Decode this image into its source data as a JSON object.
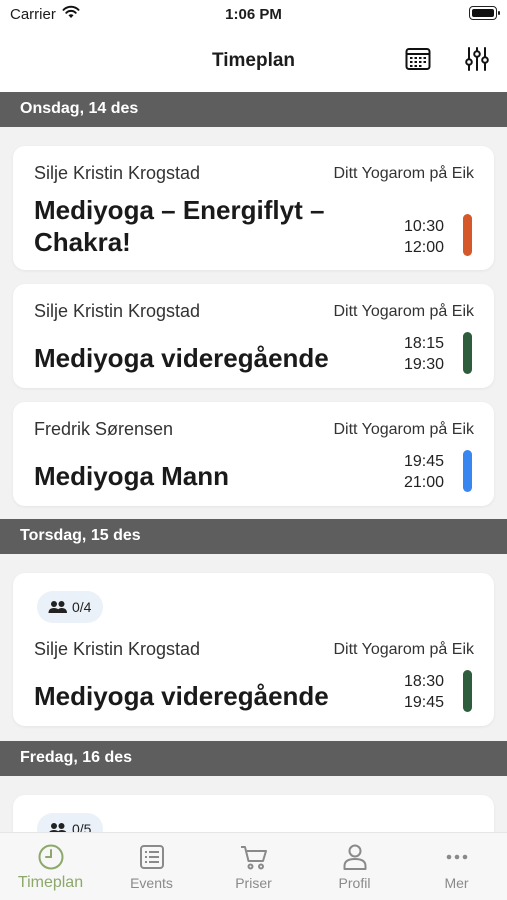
{
  "status_bar": {
    "carrier": "Carrier",
    "time": "1:06 PM"
  },
  "header": {
    "title": "Timeplan"
  },
  "sections": [
    {
      "date": "Onsdag, 14 des",
      "classes": [
        {
          "instructor": "Silje Kristin Krogstad",
          "location": "Ditt Yogarom på Eik",
          "title": "Mediyoga – Energiflyt – Chakra!",
          "start": "10:30",
          "end": "12:00",
          "color": "#d4582a"
        },
        {
          "instructor": "Silje Kristin Krogstad",
          "location": "Ditt Yogarom på Eik",
          "title": "Mediyoga videregående",
          "start": "18:15",
          "end": "19:30",
          "color": "#2d5d3c"
        },
        {
          "instructor": "Fredrik Sørensen",
          "location": "Ditt Yogarom på Eik",
          "title": "Mediyoga Mann",
          "start": "19:45",
          "end": "21:00",
          "color": "#3a86f0"
        }
      ]
    },
    {
      "date": "Torsdag, 15 des",
      "classes": [
        {
          "capacity": "0/4",
          "instructor": "Silje Kristin Krogstad",
          "location": "Ditt Yogarom på Eik",
          "title": "Mediyoga videregående",
          "start": "18:30",
          "end": "19:45",
          "color": "#2d5d3c"
        }
      ]
    },
    {
      "date": "Fredag, 16 des",
      "classes": [
        {
          "capacity": "0/5"
        }
      ]
    }
  ],
  "tabs": [
    {
      "label": "Timeplan",
      "icon": "clock-icon"
    },
    {
      "label": "Events",
      "icon": "list-icon"
    },
    {
      "label": "Priser",
      "icon": "cart-icon"
    },
    {
      "label": "Profil",
      "icon": "person-icon"
    },
    {
      "label": "Mer",
      "icon": "more-icon"
    }
  ],
  "colors": {
    "active_tab": "#8ca86a",
    "section_bg": "#5e5e5e"
  }
}
